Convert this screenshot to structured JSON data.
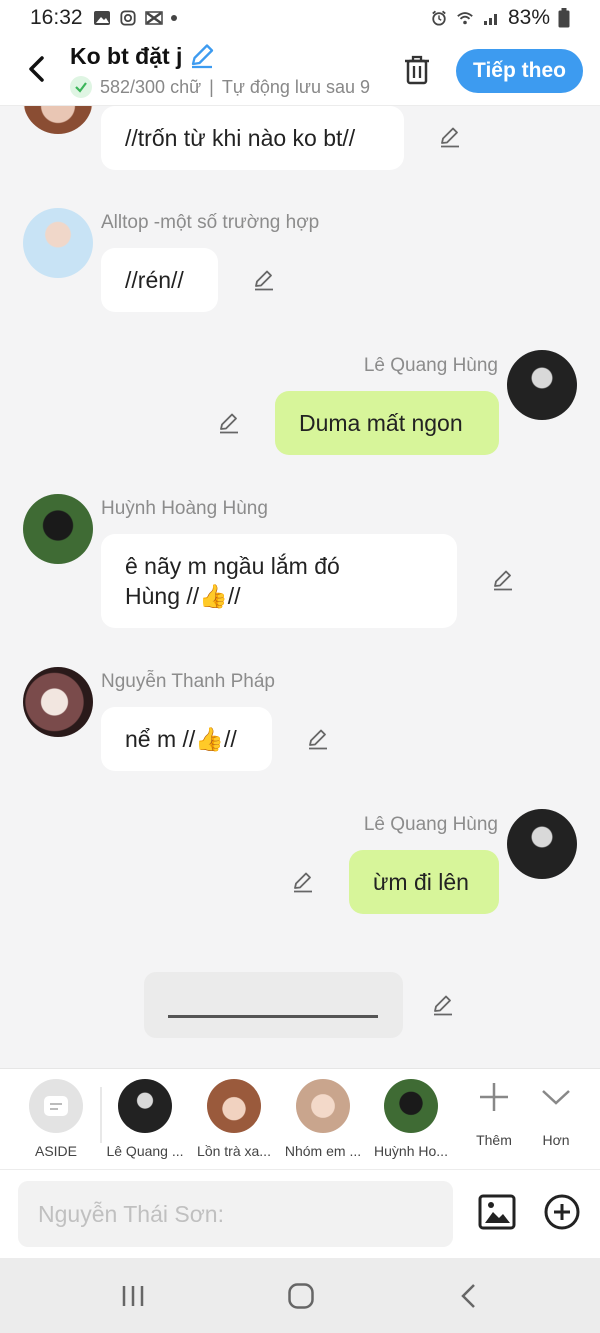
{
  "status_bar": {
    "time": "16:32",
    "battery": "83%"
  },
  "header": {
    "title": "Ko bt đặt j",
    "word_count": "582/300 chữ",
    "autosave": "Tự động lưu sau 9",
    "next_label": "Tiếp theo"
  },
  "messages": [
    {
      "text": "//trốn từ khi nào ko bt//"
    },
    {
      "sender": "Alltop -một số trường hợp",
      "text": "//rén//"
    },
    {
      "sender": "Lê Quang Hùng",
      "text": "Duma mất ngon"
    },
    {
      "sender": "Huỳnh Hoàng Hùng",
      "line1": "ê nãy m ngầu lắm đó",
      "line2_a": "Hùng //",
      "line2_b": "//"
    },
    {
      "sender": "Nguyễn Thanh Pháp",
      "text_a": "nể m //",
      "text_b": "//"
    },
    {
      "sender": "Lê Quang Hùng",
      "text": "ừm đi lên"
    }
  ],
  "characters": [
    {
      "label": "ASIDE"
    },
    {
      "label": "Lê Quang ..."
    },
    {
      "label": "Lồn trà xa..."
    },
    {
      "label": "Nhóm em ..."
    },
    {
      "label": "Huỳnh Ho..."
    }
  ],
  "actions": {
    "add_label": "Thêm",
    "more_label": "Hơn"
  },
  "composer": {
    "placeholder": "Nguyễn Thái Sơn:"
  },
  "colors": {
    "accent": "#3d9bf0",
    "own_bubble": "#d7f59a",
    "background": "#f4f4f5"
  }
}
